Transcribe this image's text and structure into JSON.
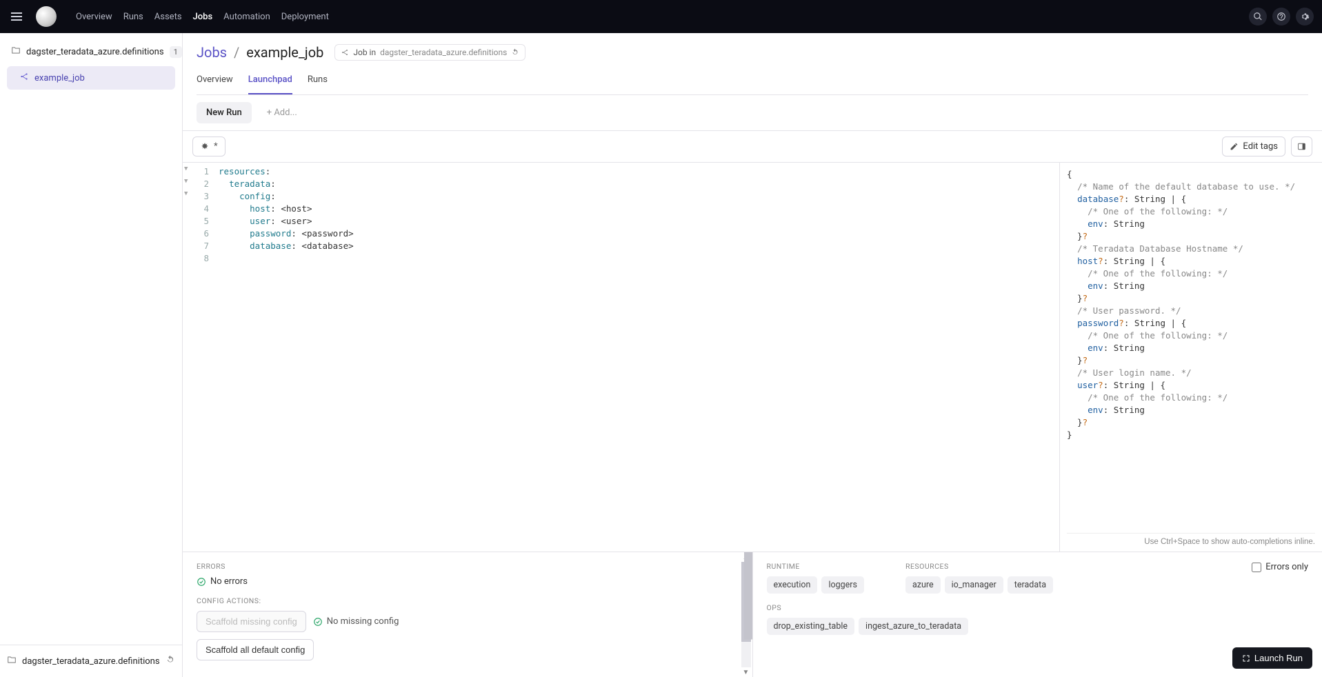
{
  "header": {
    "nav": [
      "Overview",
      "Runs",
      "Assets",
      "Jobs",
      "Automation",
      "Deployment"
    ],
    "active_nav": "Jobs"
  },
  "sidebar": {
    "folder": "dagster_teradata_azure.definitions",
    "count": "1",
    "job": "example_job",
    "footer_folder": "dagster_teradata_azure.definitions"
  },
  "page": {
    "breadcrumb_root": "Jobs",
    "breadcrumb_sep": "/",
    "breadcrumb_current": "example_job",
    "pill_prefix": "Job in",
    "pill_location": "dagster_teradata_azure.definitions",
    "tabs": [
      "Overview",
      "Launchpad",
      "Runs"
    ],
    "active_tab": "Launchpad",
    "subtab_newrun": "New Run",
    "subtab_add": "+ Add...",
    "edit_star": "*",
    "edit_tags": "Edit tags"
  },
  "editor": {
    "lines": [
      {
        "n": "1",
        "text_html": "<span class='tok-key'>resources</span><span class='tok-plain'>:</span>"
      },
      {
        "n": "2",
        "text_html": "  <span class='tok-key'>teradata</span><span class='tok-plain'>:</span>"
      },
      {
        "n": "3",
        "text_html": "    <span class='tok-key'>config</span><span class='tok-plain'>:</span>"
      },
      {
        "n": "4",
        "text_html": "      <span class='tok-key'>host</span><span class='tok-plain'>: &lt;host&gt;</span>"
      },
      {
        "n": "5",
        "text_html": "      <span class='tok-key'>user</span><span class='tok-plain'>: &lt;user&gt;</span>"
      },
      {
        "n": "6",
        "text_html": "      <span class='tok-key'>password</span><span class='tok-plain'>: &lt;password&gt;</span>"
      },
      {
        "n": "7",
        "text_html": "      <span class='tok-key'>database</span><span class='tok-plain'>: &lt;database&gt;</span>"
      },
      {
        "n": "8",
        "text_html": ""
      }
    ]
  },
  "schema": {
    "body_html": "{\n  <span class='sch-comment'>/* Name of the default database to use. */</span>\n  <span class='sch-key'>database</span><span class='sch-q'>?</span>: String | {\n    <span class='sch-comment'>/* One of the following: */</span>\n    <span class='sch-key'>env</span>: String\n  }<span class='sch-q'>?</span>\n  <span class='sch-comment'>/* Teradata Database Hostname */</span>\n  <span class='sch-key'>host</span><span class='sch-q'>?</span>: String | {\n    <span class='sch-comment'>/* One of the following: */</span>\n    <span class='sch-key'>env</span>: String\n  }<span class='sch-q'>?</span>\n  <span class='sch-comment'>/* User password. */</span>\n  <span class='sch-key'>password</span><span class='sch-q'>?</span>: String | {\n    <span class='sch-comment'>/* One of the following: */</span>\n    <span class='sch-key'>env</span>: String\n  }<span class='sch-q'>?</span>\n  <span class='sch-comment'>/* User login name. */</span>\n  <span class='sch-key'>user</span><span class='sch-q'>?</span>: String | {\n    <span class='sch-comment'>/* One of the following: */</span>\n    <span class='sch-key'>env</span>: String\n  }<span class='sch-q'>?</span>\n}",
    "hint": "Use Ctrl+Space to show auto-completions inline."
  },
  "bottom": {
    "errors_label": "ERRORS",
    "no_errors": "No errors",
    "config_actions_label": "CONFIG ACTIONS:",
    "scaffold_missing": "Scaffold missing config",
    "no_missing": "No missing config",
    "scaffold_all": "Scaffold all default config",
    "runtime_label": "RUNTIME",
    "resources_label": "RESOURCES",
    "ops_label": "OPS",
    "runtime_tags": [
      "execution",
      "loggers"
    ],
    "resource_tags": [
      "azure",
      "io_manager",
      "teradata"
    ],
    "ops_tags": [
      "drop_existing_table",
      "ingest_azure_to_teradata"
    ],
    "errors_only": "Errors only",
    "launch": "Launch Run"
  }
}
